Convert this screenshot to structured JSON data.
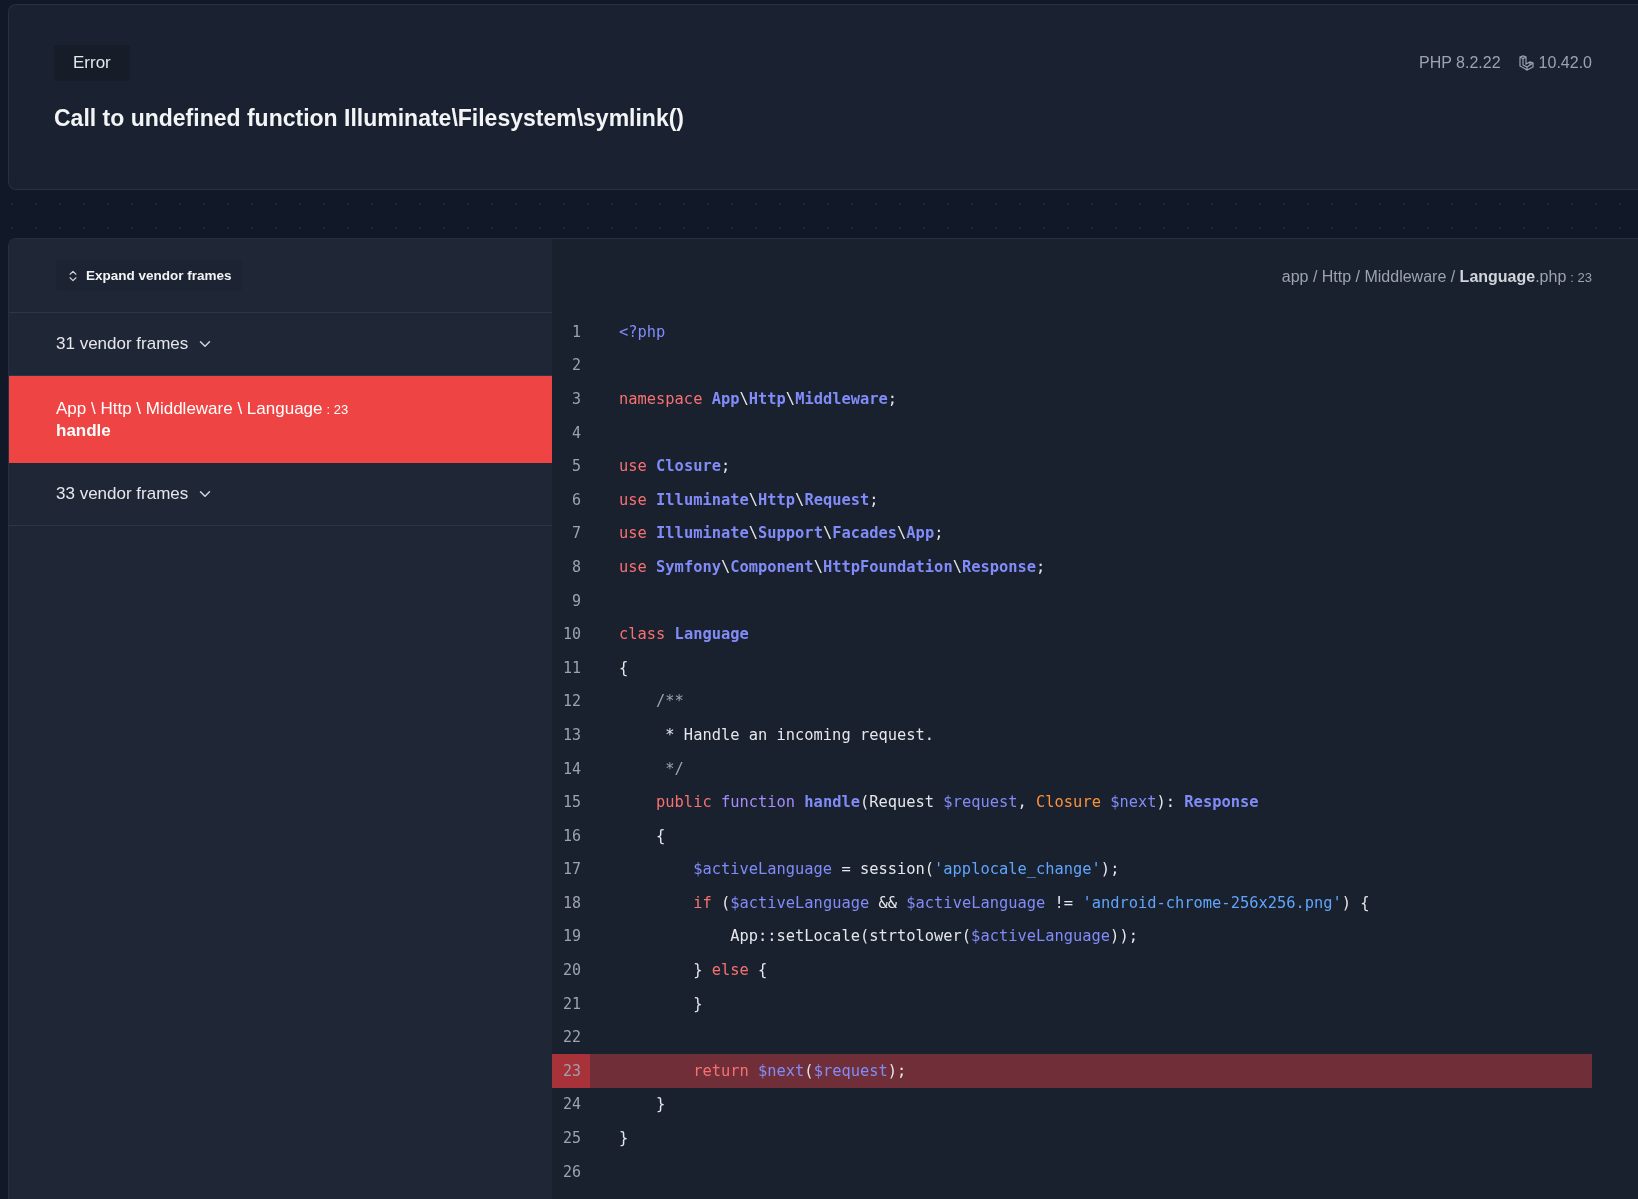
{
  "header": {
    "badge": "Error",
    "title": "Call to undefined function Illuminate\\Filesystem\\symlink()",
    "php_version": "PHP 8.2.22",
    "laravel_version": "10.42.0"
  },
  "sidebar": {
    "expand_button": "Expand vendor frames",
    "frames": [
      {
        "kind": "vendor",
        "label": "31 vendor frames",
        "expanded": false
      },
      {
        "kind": "app",
        "selected": true,
        "location": "App \\ Http \\ Middleware \\ Language",
        "line": ": 23",
        "method": "handle"
      },
      {
        "kind": "vendor",
        "label": "33 vendor frames",
        "expanded": false
      }
    ]
  },
  "code": {
    "path": "app / Http / Middleware / **Language**.php",
    "line": ": 23",
    "lines": [
      {
        "number": "1",
        "highlighted": false,
        "tokens": [
          {
            "kind": "tag",
            "text": "<?php"
          }
        ]
      },
      {
        "number": "2",
        "highlighted": false
      },
      {
        "number": "3",
        "highlighted": false,
        "tokens": [
          {
            "kind": "keyword",
            "text": "namespace "
          },
          {
            "kind": "class",
            "text": "App"
          },
          {
            "kind": "plain",
            "text": "\\"
          },
          {
            "kind": "class",
            "text": "Http"
          },
          {
            "kind": "plain",
            "text": "\\"
          },
          {
            "kind": "class",
            "text": "Middleware"
          },
          {
            "kind": "plain",
            "text": ";"
          }
        ]
      },
      {
        "number": "4",
        "highlighted": false
      },
      {
        "number": "5",
        "highlighted": false,
        "tokens": [
          {
            "kind": "keyword",
            "text": "use "
          },
          {
            "kind": "class",
            "text": "Closure"
          },
          {
            "kind": "plain",
            "text": ";"
          }
        ]
      },
      {
        "number": "6",
        "highlighted": false,
        "tokens": [
          {
            "kind": "keyword",
            "text": "use "
          },
          {
            "kind": "class",
            "text": "Illuminate"
          },
          {
            "kind": "plain",
            "text": "\\"
          },
          {
            "kind": "class",
            "text": "Http"
          },
          {
            "kind": "plain",
            "text": "\\"
          },
          {
            "kind": "class",
            "text": "Request"
          },
          {
            "kind": "plain",
            "text": ";"
          }
        ]
      },
      {
        "number": "7",
        "highlighted": false,
        "tokens": [
          {
            "kind": "keyword",
            "text": "use "
          },
          {
            "kind": "class",
            "text": "Illuminate"
          },
          {
            "kind": "plain",
            "text": "\\"
          },
          {
            "kind": "class",
            "text": "Support"
          },
          {
            "kind": "plain",
            "text": "\\"
          },
          {
            "kind": "class",
            "text": "Facades"
          },
          {
            "kind": "plain",
            "text": "\\"
          },
          {
            "kind": "class",
            "text": "App"
          },
          {
            "kind": "plain",
            "text": ";"
          }
        ]
      },
      {
        "number": "8",
        "highlighted": false,
        "tokens": [
          {
            "kind": "keyword",
            "text": "use "
          },
          {
            "kind": "class",
            "text": "Symfony"
          },
          {
            "kind": "plain",
            "text": "\\"
          },
          {
            "kind": "class",
            "text": "Component"
          },
          {
            "kind": "plain",
            "text": "\\"
          },
          {
            "kind": "class",
            "text": "HttpFoundation"
          },
          {
            "kind": "plain",
            "text": "\\"
          },
          {
            "kind": "class",
            "text": "Response"
          },
          {
            "kind": "plain",
            "text": ";"
          }
        ]
      },
      {
        "number": "9",
        "highlighted": false
      },
      {
        "number": "10",
        "highlighted": false,
        "tokens": [
          {
            "kind": "keyword",
            "text": "class "
          },
          {
            "kind": "class",
            "text": "Language"
          }
        ]
      },
      {
        "number": "11",
        "highlighted": false,
        "tokens": [
          {
            "kind": "plain",
            "text": "{"
          }
        ]
      },
      {
        "number": "12",
        "highlighted": false,
        "tokens": [
          {
            "kind": "comment",
            "text": "    /**"
          }
        ]
      },
      {
        "number": "13",
        "highlighted": false,
        "tokens": [
          {
            "kind": "plain",
            "text": "     * Handle an incoming request."
          }
        ]
      },
      {
        "number": "14",
        "highlighted": false,
        "tokens": [
          {
            "kind": "comment",
            "text": "     */"
          }
        ]
      },
      {
        "number": "15",
        "highlighted": false,
        "tokens": [
          {
            "kind": "keyword",
            "text": "    public "
          },
          {
            "kind": "storage",
            "text": "function "
          },
          {
            "kind": "class",
            "text": "handle"
          },
          {
            "kind": "plain",
            "text": "(Request "
          },
          {
            "kind": "variable",
            "text": "$request"
          },
          {
            "kind": "plain",
            "text": ", "
          },
          {
            "kind": "type",
            "text": "Closure "
          },
          {
            "kind": "variable",
            "text": "$next"
          },
          {
            "kind": "plain",
            "text": "): "
          },
          {
            "kind": "class",
            "text": "Response"
          }
        ]
      },
      {
        "number": "16",
        "highlighted": false,
        "tokens": [
          {
            "kind": "plain",
            "text": "    {"
          }
        ]
      },
      {
        "number": "17",
        "highlighted": false,
        "tokens": [
          {
            "kind": "variable",
            "text": "        $activeLanguage"
          },
          {
            "kind": "plain",
            "text": " = session("
          },
          {
            "kind": "string",
            "text": "'applocale_change'"
          },
          {
            "kind": "plain",
            "text": ");"
          }
        ]
      },
      {
        "number": "18",
        "highlighted": false,
        "tokens": [
          {
            "kind": "keyword",
            "text": "        if "
          },
          {
            "kind": "plain",
            "text": "("
          },
          {
            "kind": "variable",
            "text": "$activeLanguage"
          },
          {
            "kind": "plain",
            "text": " && "
          },
          {
            "kind": "variable",
            "text": "$activeLanguage"
          },
          {
            "kind": "plain",
            "text": " != "
          },
          {
            "kind": "string",
            "text": "'android-chrome-256x256.png'"
          },
          {
            "kind": "plain",
            "text": ") {"
          }
        ]
      },
      {
        "number": "19",
        "highlighted": false,
        "tokens": [
          {
            "kind": "plain",
            "text": "            App::setLocale(strtolower("
          },
          {
            "kind": "variable",
            "text": "$activeLanguage"
          },
          {
            "kind": "plain",
            "text": "));"
          }
        ]
      },
      {
        "number": "20",
        "highlighted": false,
        "tokens": [
          {
            "kind": "plain",
            "text": "        } "
          },
          {
            "kind": "keyword",
            "text": "else "
          },
          {
            "kind": "plain",
            "text": "{"
          }
        ]
      },
      {
        "number": "21",
        "highlighted": false,
        "tokens": [
          {
            "kind": "plain",
            "text": "        }"
          }
        ]
      },
      {
        "number": "22",
        "highlighted": false
      },
      {
        "number": "23",
        "highlighted": true,
        "tokens": [
          {
            "kind": "keyword",
            "text": "        return "
          },
          {
            "kind": "variable",
            "text": "$next"
          },
          {
            "kind": "plain",
            "text": "("
          },
          {
            "kind": "variable",
            "text": "$request"
          },
          {
            "kind": "plain",
            "text": ");"
          }
        ]
      },
      {
        "number": "24",
        "highlighted": false,
        "tokens": [
          {
            "kind": "plain",
            "text": "    }"
          }
        ]
      },
      {
        "number": "25",
        "highlighted": false,
        "tokens": [
          {
            "kind": "plain",
            "text": "}"
          }
        ]
      },
      {
        "number": "26",
        "highlighted": false
      }
    ]
  }
}
